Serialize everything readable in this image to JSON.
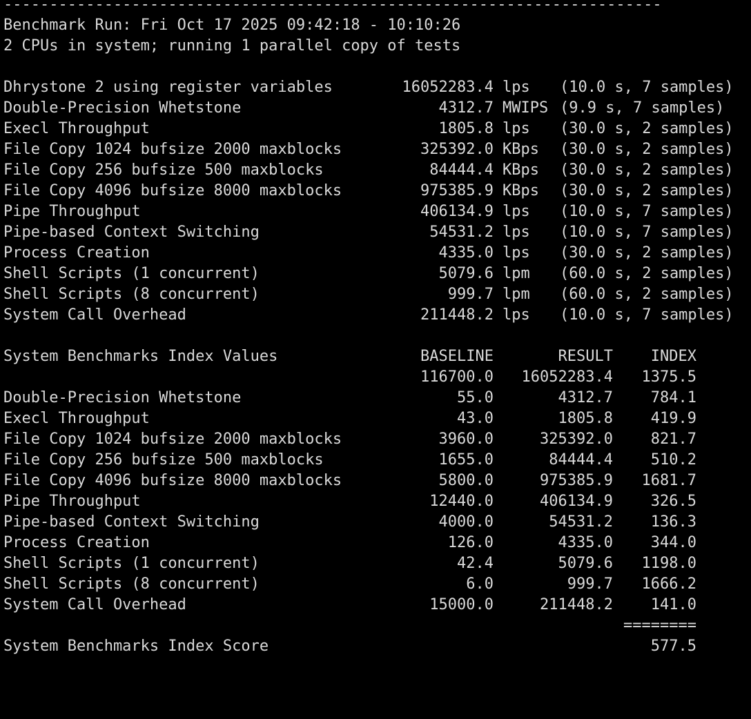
{
  "separator": "------------------------------------------------------------------------",
  "header": {
    "run_line": "Benchmark Run: Fri Oct 17 2025 09:42:18 - 10:10:26",
    "cpu_line": "2 CPUs in system; running 1 parallel copy of tests"
  },
  "results": [
    {
      "name": "Dhrystone 2 using register variables",
      "value": "16052283.4",
      "unit": "lps",
      "detail": "(10.0 s, 7 samples)"
    },
    {
      "name": "Double-Precision Whetstone",
      "value": "4312.7",
      "unit": "MWIPS",
      "detail": "(9.9 s, 7 samples)"
    },
    {
      "name": "Execl Throughput",
      "value": "1805.8",
      "unit": "lps",
      "detail": "(30.0 s, 2 samples)"
    },
    {
      "name": "File Copy 1024 bufsize 2000 maxblocks",
      "value": "325392.0",
      "unit": "KBps",
      "detail": "(30.0 s, 2 samples)"
    },
    {
      "name": "File Copy 256 bufsize 500 maxblocks",
      "value": "84444.4",
      "unit": "KBps",
      "detail": "(30.0 s, 2 samples)"
    },
    {
      "name": "File Copy 4096 bufsize 8000 maxblocks",
      "value": "975385.9",
      "unit": "KBps",
      "detail": "(30.0 s, 2 samples)"
    },
    {
      "name": "Pipe Throughput",
      "value": "406134.9",
      "unit": "lps",
      "detail": "(10.0 s, 7 samples)"
    },
    {
      "name": "Pipe-based Context Switching",
      "value": "54531.2",
      "unit": "lps",
      "detail": "(10.0 s, 7 samples)"
    },
    {
      "name": "Process Creation",
      "value": "4335.0",
      "unit": "lps",
      "detail": "(30.0 s, 2 samples)"
    },
    {
      "name": "Shell Scripts (1 concurrent)",
      "value": "5079.6",
      "unit": "lpm",
      "detail": "(60.0 s, 2 samples)"
    },
    {
      "name": "Shell Scripts (8 concurrent)",
      "value": "999.7",
      "unit": "lpm",
      "detail": "(60.0 s, 2 samples)"
    },
    {
      "name": "System Call Overhead",
      "value": "211448.2",
      "unit": "lps",
      "detail": "(10.0 s, 7 samples)"
    }
  ],
  "index_table": {
    "title": "System Benchmarks Index Values",
    "col_baseline": "BASELINE",
    "col_result": "RESULT",
    "col_index": "INDEX",
    "rows": [
      {
        "name": "",
        "baseline": "116700.0",
        "result": "16052283.4",
        "index": "1375.5"
      },
      {
        "name": "Double-Precision Whetstone",
        "baseline": "55.0",
        "result": "4312.7",
        "index": "784.1"
      },
      {
        "name": "Execl Throughput",
        "baseline": "43.0",
        "result": "1805.8",
        "index": "419.9"
      },
      {
        "name": "File Copy 1024 bufsize 2000 maxblocks",
        "baseline": "3960.0",
        "result": "325392.0",
        "index": "821.7"
      },
      {
        "name": "File Copy 256 bufsize 500 maxblocks",
        "baseline": "1655.0",
        "result": "84444.4",
        "index": "510.2"
      },
      {
        "name": "File Copy 4096 bufsize 8000 maxblocks",
        "baseline": "5800.0",
        "result": "975385.9",
        "index": "1681.7"
      },
      {
        "name": "Pipe Throughput",
        "baseline": "12440.0",
        "result": "406134.9",
        "index": "326.5"
      },
      {
        "name": "Pipe-based Context Switching",
        "baseline": "4000.0",
        "result": "54531.2",
        "index": "136.3"
      },
      {
        "name": "Process Creation",
        "baseline": "126.0",
        "result": "4335.0",
        "index": "344.0"
      },
      {
        "name": "Shell Scripts (1 concurrent)",
        "baseline": "42.4",
        "result": "5079.6",
        "index": "1198.0"
      },
      {
        "name": "Shell Scripts (8 concurrent)",
        "baseline": "6.0",
        "result": "999.7",
        "index": "1666.2"
      },
      {
        "name": "System Call Overhead",
        "baseline": "15000.0",
        "result": "211448.2",
        "index": "141.0"
      }
    ],
    "rule": "========",
    "score_label": "System Benchmarks Index Score",
    "score_value": "577.5"
  }
}
